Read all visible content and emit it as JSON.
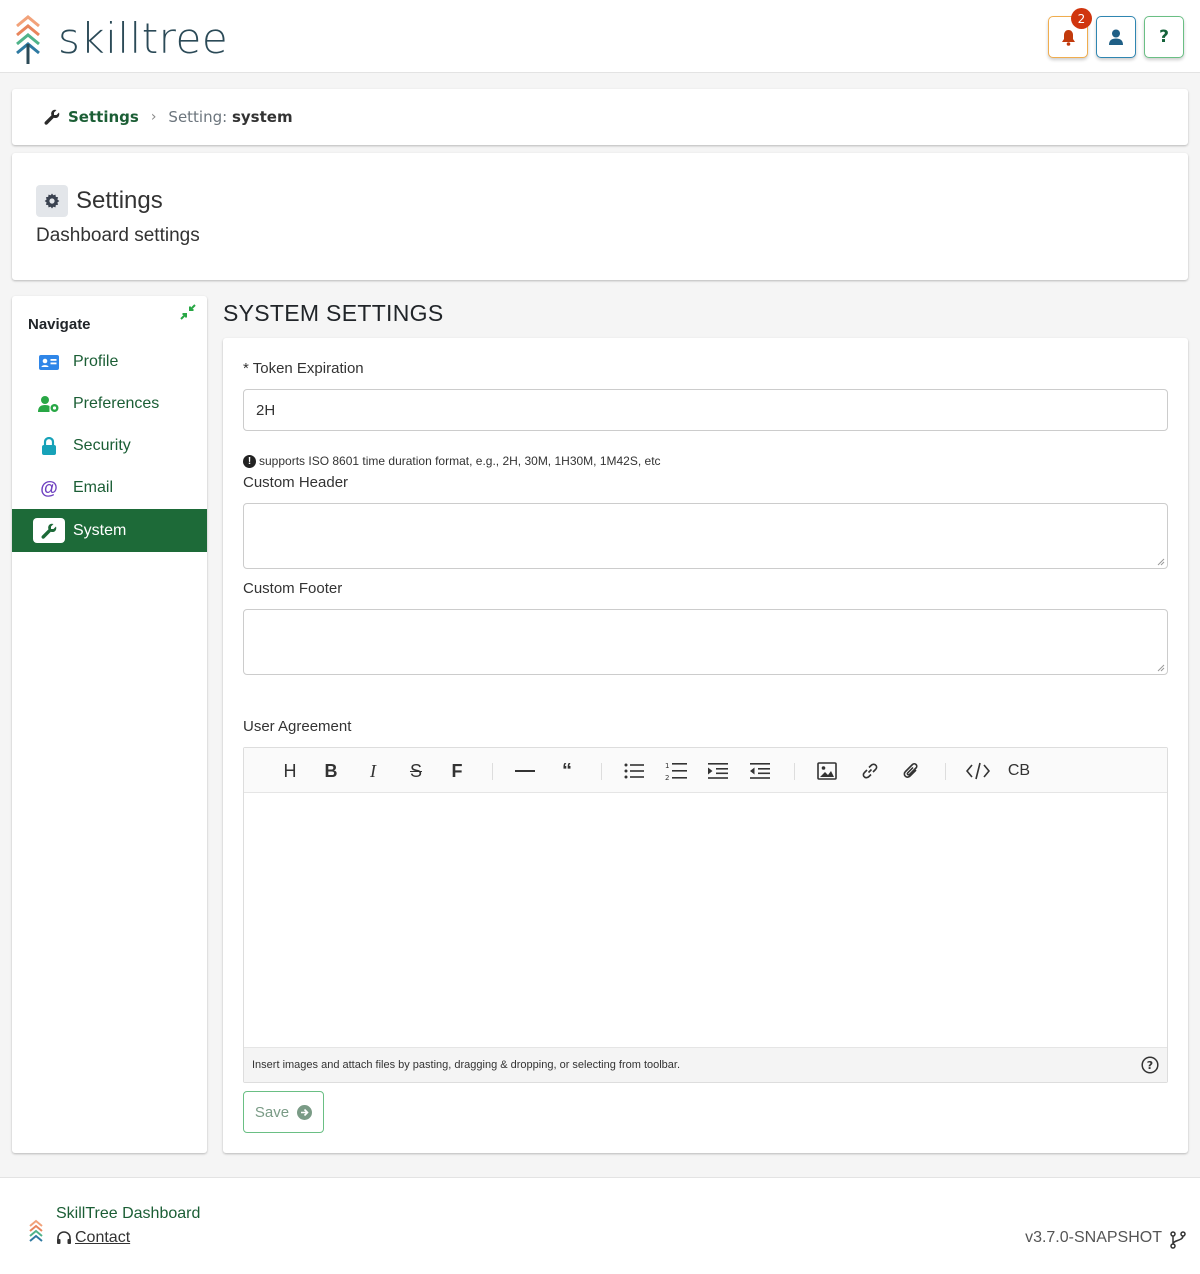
{
  "header": {
    "logo_text": "skilltree",
    "notification_count": "2",
    "help_label": "?"
  },
  "breadcrumb": {
    "root": "Settings",
    "current_prefix": "Setting:",
    "current_value": "system"
  },
  "title_card": {
    "title": "Settings",
    "subtitle": "Dashboard settings"
  },
  "sidebar": {
    "title": "Navigate",
    "items": [
      {
        "label": "Profile",
        "icon": "id-card-icon",
        "color": "#2f86e8"
      },
      {
        "label": "Preferences",
        "icon": "user-cog-icon",
        "color": "#28a745"
      },
      {
        "label": "Security",
        "icon": "lock-icon",
        "color": "#17a2b8"
      },
      {
        "label": "Email",
        "icon": "at-icon",
        "color": "#6f42c1"
      },
      {
        "label": "System",
        "icon": "wrench-icon",
        "color": "#1d6a38",
        "active": true
      }
    ]
  },
  "main": {
    "section_title": "SYSTEM SETTINGS",
    "token_label": "* Token Expiration",
    "token_value": "2H",
    "token_hint": "supports ISO 8601 time duration format, e.g., 2H, 30M, 1H30M, 1M42S, etc",
    "custom_header_label": "Custom Header",
    "custom_footer_label": "Custom Footer",
    "user_agreement_label": "User Agreement",
    "editor_footer_text": "Insert images and attach files by pasting, dragging & dropping, or selecting from toolbar.",
    "toolbar": {
      "heading": "H",
      "bold": "B",
      "italic": "I",
      "strike": "S",
      "font": "F",
      "codeblock": "CB"
    },
    "save_label": "Save"
  },
  "footer": {
    "name": "SkillTree Dashboard",
    "contact": "Contact",
    "version": "v3.7.0-SNAPSHOT"
  },
  "colors": {
    "primary_green": "#1d6a38",
    "link_green": "#1b5e35",
    "notification_red": "#d0350e"
  }
}
